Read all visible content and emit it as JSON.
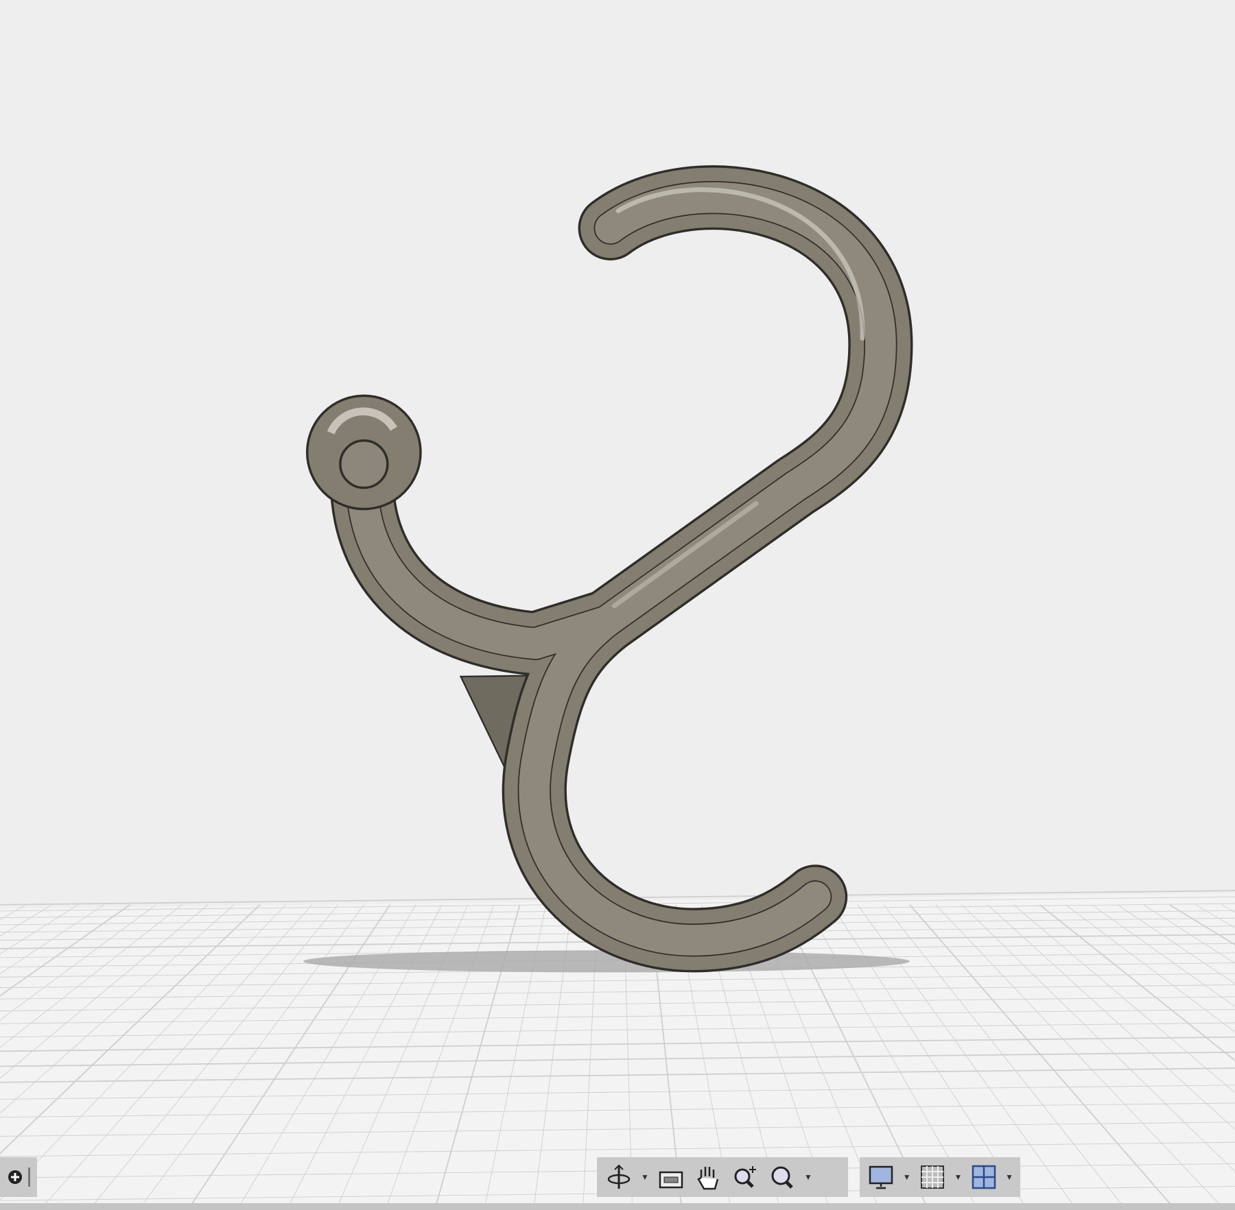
{
  "viewport": {
    "background": "#eeeeee",
    "model_color": "#85806f",
    "grid_color": "#cfcfcf"
  },
  "toolbar": {
    "navigation_icons": [
      "orbit-icon",
      "look-at-icon",
      "pan-icon",
      "zoom-icon",
      "fit-icon"
    ],
    "display_icons": [
      "display-settings-icon",
      "grid-settings-icon",
      "viewports-icon"
    ]
  }
}
